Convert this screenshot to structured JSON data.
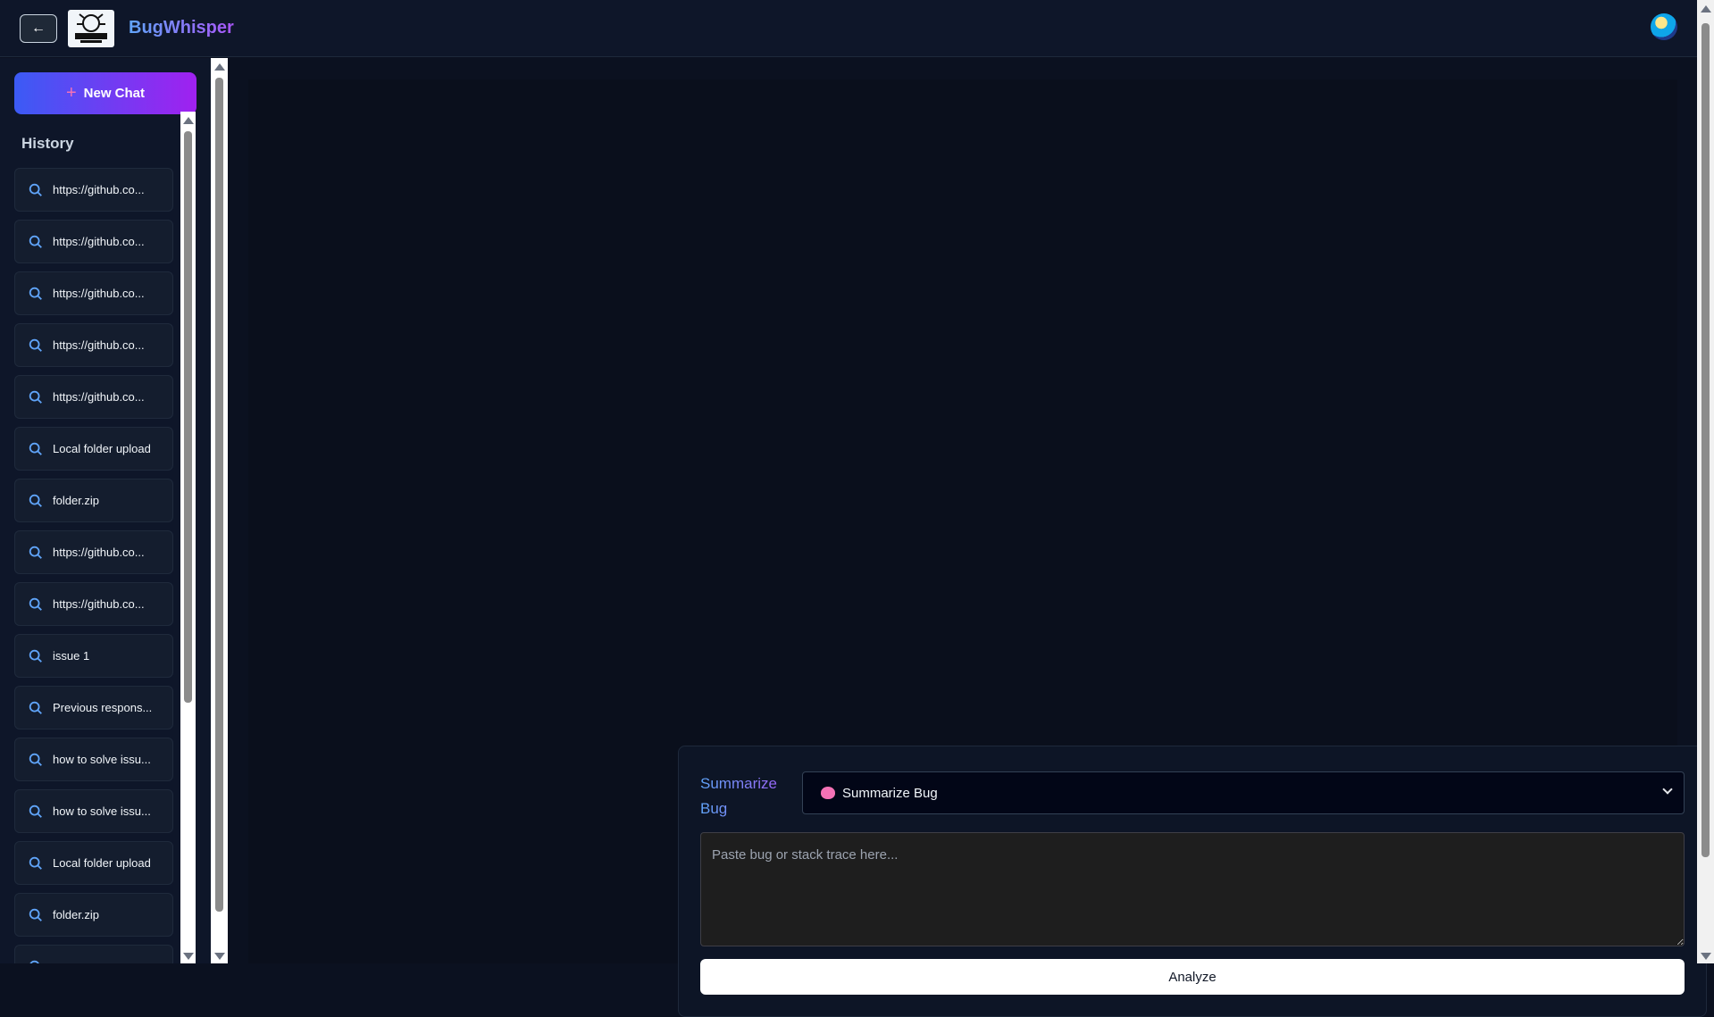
{
  "header": {
    "back_label": "←",
    "brand": "BugWhisper",
    "logo_text": "BUGWHISPER"
  },
  "sidebar": {
    "new_chat_label": "New Chat",
    "new_chat_plus": "+",
    "history_title": "History",
    "items": [
      {
        "label": "https://github.co..."
      },
      {
        "label": "https://github.co..."
      },
      {
        "label": "https://github.co..."
      },
      {
        "label": "https://github.co..."
      },
      {
        "label": "https://github.co..."
      },
      {
        "label": "Local folder upload"
      },
      {
        "label": "folder.zip"
      },
      {
        "label": "https://github.co..."
      },
      {
        "label": "https://github.co..."
      },
      {
        "label": "issue 1"
      },
      {
        "label": "Previous respons..."
      },
      {
        "label": "how to solve issu..."
      },
      {
        "label": "how to solve issu..."
      },
      {
        "label": "Local folder upload"
      },
      {
        "label": "folder.zip"
      },
      {
        "label": ""
      }
    ],
    "item_icon": "search-icon"
  },
  "panel": {
    "mode_label": "Summarize Bug",
    "mode_selected": "Summarize Bug",
    "mode_icon": "brain-icon",
    "input_placeholder": "Paste bug or stack trace here...",
    "analyze_label": "Analyze"
  },
  "colors": {
    "accent_start": "#3b5bf5",
    "accent_end": "#a021f0",
    "background": "#0b1120"
  }
}
